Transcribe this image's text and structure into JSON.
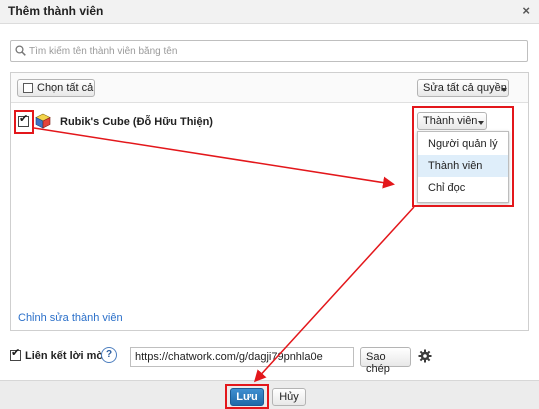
{
  "dialog": {
    "title": "Thêm thành viên",
    "close_glyph": "×"
  },
  "search": {
    "placeholder": "Tìm kiếm tên thành viên bằng tên",
    "value": ""
  },
  "toolbar": {
    "select_all_label": "Chọn tất cả",
    "edit_all_label": "Sửa tất cả quyền"
  },
  "members": [
    {
      "name": "Rubik's Cube (Đỗ Hữu Thiện)",
      "checked": true,
      "role": "Thành viên",
      "avatar_icon": "rubiks-cube-icon"
    }
  ],
  "role_menu": {
    "options": [
      "Người quản lý",
      "Thành viên",
      "Chỉ đọc"
    ],
    "highlighted": "Thành viên"
  },
  "edit_members_link": "Chỉnh sửa thành viên",
  "invite": {
    "label": "Liên kết lời mời",
    "checked": true,
    "help_glyph": "?",
    "url": "https://chatwork.com/g/dagji79pnhla0e",
    "copy_label": "Sao chép",
    "settings_icon": "gear-icon"
  },
  "footer": {
    "save_label": "Lưu",
    "cancel_label": "Hủy"
  },
  "colors": {
    "annotation": "#e3171b",
    "link": "#2a6fc9",
    "primary": "#1f6aa8",
    "highlight": "#dfeefa"
  }
}
